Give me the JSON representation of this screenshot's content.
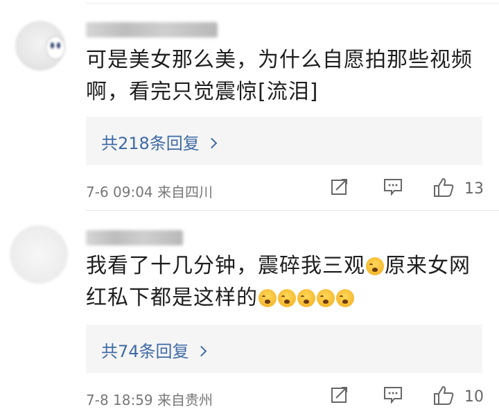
{
  "comments": [
    {
      "avatar": "avatar-image",
      "text_segments": [
        "可是美女那么美，为什么自愿拍那些视频啊，看完只觉震惊[流泪]"
      ],
      "replies_label": "共218条回复",
      "timestamp": "7-6 09:04",
      "location": "来自四川",
      "like_count": "13"
    },
    {
      "avatar": "avatar-image",
      "text_segments": [
        "我看了十几分钟，震碎我三观",
        "原来女网红私下都是这样的"
      ],
      "replies_label": "共74条回复",
      "timestamp": "7-8 18:59",
      "location": "来自贵州",
      "like_count": "10"
    }
  ],
  "icons": {
    "share": "share-icon",
    "comment": "comment-icon",
    "like": "thumbs-up-icon",
    "emoji": "crying-face-emoji"
  },
  "colors": {
    "link": "#3e6aa6",
    "meta": "#777777",
    "reply_bg": "#f5f5f5"
  }
}
